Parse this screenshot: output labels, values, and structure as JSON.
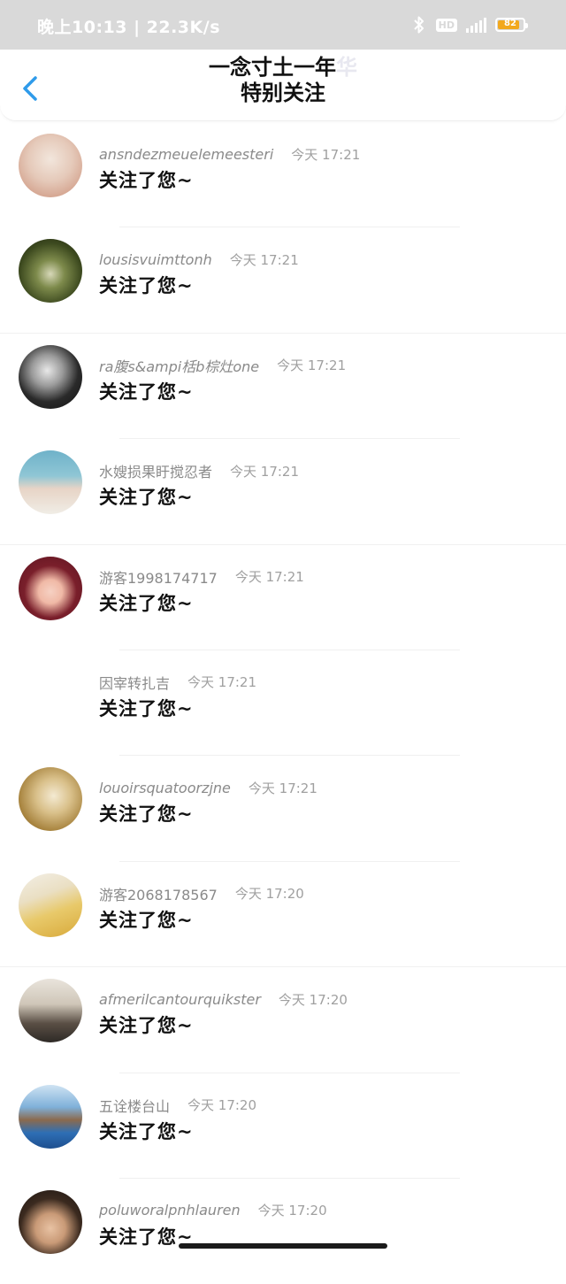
{
  "status_bar": {
    "time_speed": "晚上10:13 | 22.3K/s",
    "hd_label": "HD",
    "battery": "82"
  },
  "header": {
    "nickname": "一念寸土一年",
    "nickname_tail": "华",
    "title": "特别关注"
  },
  "items": [
    {
      "username": "ansndezmeuelemeesteri",
      "time": "今天 17:21",
      "message": "关注了您~"
    },
    {
      "username": "lousisvuimttonh",
      "time": "今天 17:21",
      "message": "关注了您~"
    },
    {
      "username": "ra腹s&ampi栝b棕灶one",
      "time": "今天 17:21",
      "message": "关注了您~"
    },
    {
      "username": "水嫂损果盱搅忍者",
      "time": "今天 17:21",
      "message": "关注了您~"
    },
    {
      "username": "游客1998174717",
      "time": "今天 17:21",
      "message": "关注了您~"
    },
    {
      "username": "因宰转扎吉",
      "time": "今天 17:21",
      "message": "关注了您~"
    },
    {
      "username": "louoirsquatoorzjne",
      "time": "今天 17:21",
      "message": "关注了您~"
    },
    {
      "username": "游客2068178567",
      "time": "今天 17:20",
      "message": "关注了您~"
    },
    {
      "username": "afmerilcantourquikster",
      "time": "今天 17:20",
      "message": "关注了您~"
    },
    {
      "username": "五诠楼台山",
      "time": "今天 17:20",
      "message": "关注了您~"
    },
    {
      "username": "poluworalpnhlauren",
      "time": "今天 17:20",
      "message": "关注了您~"
    }
  ]
}
